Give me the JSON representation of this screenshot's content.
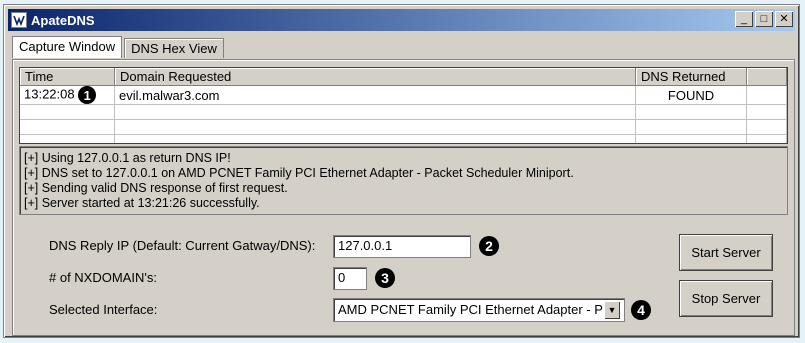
{
  "window": {
    "title": "ApateDNS",
    "controls": {
      "minimize": "_",
      "maximize": "□",
      "close": "✕"
    }
  },
  "tabs": [
    {
      "label": "Capture Window",
      "active": true
    },
    {
      "label": "DNS Hex View",
      "active": false
    }
  ],
  "table": {
    "columns": [
      "Time",
      "Domain Requested",
      "DNS Returned",
      ""
    ],
    "rows": [
      {
        "time": "13:22:08",
        "domain": "evil.malwar3.com",
        "dns": "FOUND",
        "marker": "1"
      }
    ]
  },
  "log": [
    "[+] Using 127.0.0.1 as return DNS IP!",
    "[+] DNS set to 127.0.0.1 on AMD PCNET Family PCI Ethernet Adapter - Packet Scheduler Miniport.",
    "[+] Sending valid DNS response of first request.",
    "[+] Server started at 13:21:26 successfully."
  ],
  "settings": {
    "reply_ip_label": "DNS Reply IP (Default: Current Gatway/DNS):",
    "reply_ip_value": "127.0.0.1",
    "reply_ip_marker": "2",
    "nxdomain_label": "# of NXDOMAIN's:",
    "nxdomain_value": "0",
    "nxdomain_marker": "3",
    "interface_label": "Selected Interface:",
    "interface_value": "AMD PCNET Family PCI Ethernet Adapter - P",
    "interface_marker": "4"
  },
  "buttons": {
    "start": "Start Server",
    "stop": "Stop Server"
  }
}
